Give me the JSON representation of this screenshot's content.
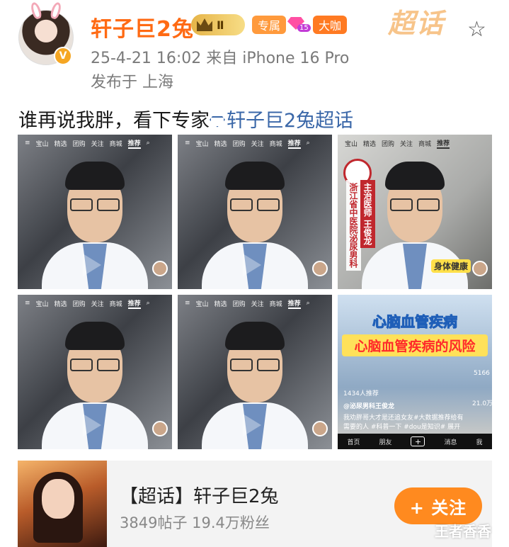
{
  "post": {
    "username": "轩子巨2兔",
    "vip_level_badge": "Ⅱ",
    "exclusive_tag": "专属",
    "fan_level": "15",
    "bigshot_tag": "大咖",
    "chaohua_logo": "超话",
    "timestamp_source": "25-4-21 16:02  来自 iPhone 16 Pro",
    "location": "发布于 上海",
    "text": "谁再说我胖，看下专家",
    "topic_link": "轩子巨2兔超话"
  },
  "grid": {
    "tiles": [
      {
        "tabs": [
          "宝山",
          "精选",
          "团购",
          "关注",
          "商城",
          "推荐"
        ]
      },
      {
        "tabs": [
          "宝山",
          "精选",
          "团购",
          "关注",
          "商城",
          "推荐"
        ]
      },
      {
        "tabs": [
          "宝山",
          "精选",
          "团购",
          "关注",
          "商城",
          "推荐"
        ],
        "hospital": "浙江省中医院泌尿男科",
        "title": "主治医师 王俊龙",
        "sticker": "身体健康"
      },
      {
        "tabs": [
          "宝山",
          "精选",
          "团购",
          "关注",
          "商城",
          "推荐"
        ]
      },
      {
        "tabs": [
          "宝山",
          "精选",
          "团购",
          "关注",
          "商城",
          "推荐"
        ]
      },
      {
        "headline1": "心脑血管疾病",
        "headline2": "心脑血管疾病的风险",
        "likes": "1434人推荐",
        "author": "@泌尿男科王俊龙",
        "caption1": "我劝胖哥大才是还追女友#大数据推荐给有",
        "caption2": "需要的人 #科普一下 #dou是知识# 展开",
        "stat1": "5166",
        "stat2": "21.0万",
        "nav": [
          "首页",
          "朋友",
          "+",
          "消息",
          "我"
        ]
      }
    ]
  },
  "topic_card": {
    "title": "【超话】轩子巨2兔",
    "stats": "3849帖子  19.4万粉丝",
    "follow_label": "+ 关注"
  },
  "watermark": "王者香香",
  "colors": {
    "username": "#ff6a13",
    "topic_link": "#3a67a8",
    "follow_button": "#ff8a1f"
  }
}
